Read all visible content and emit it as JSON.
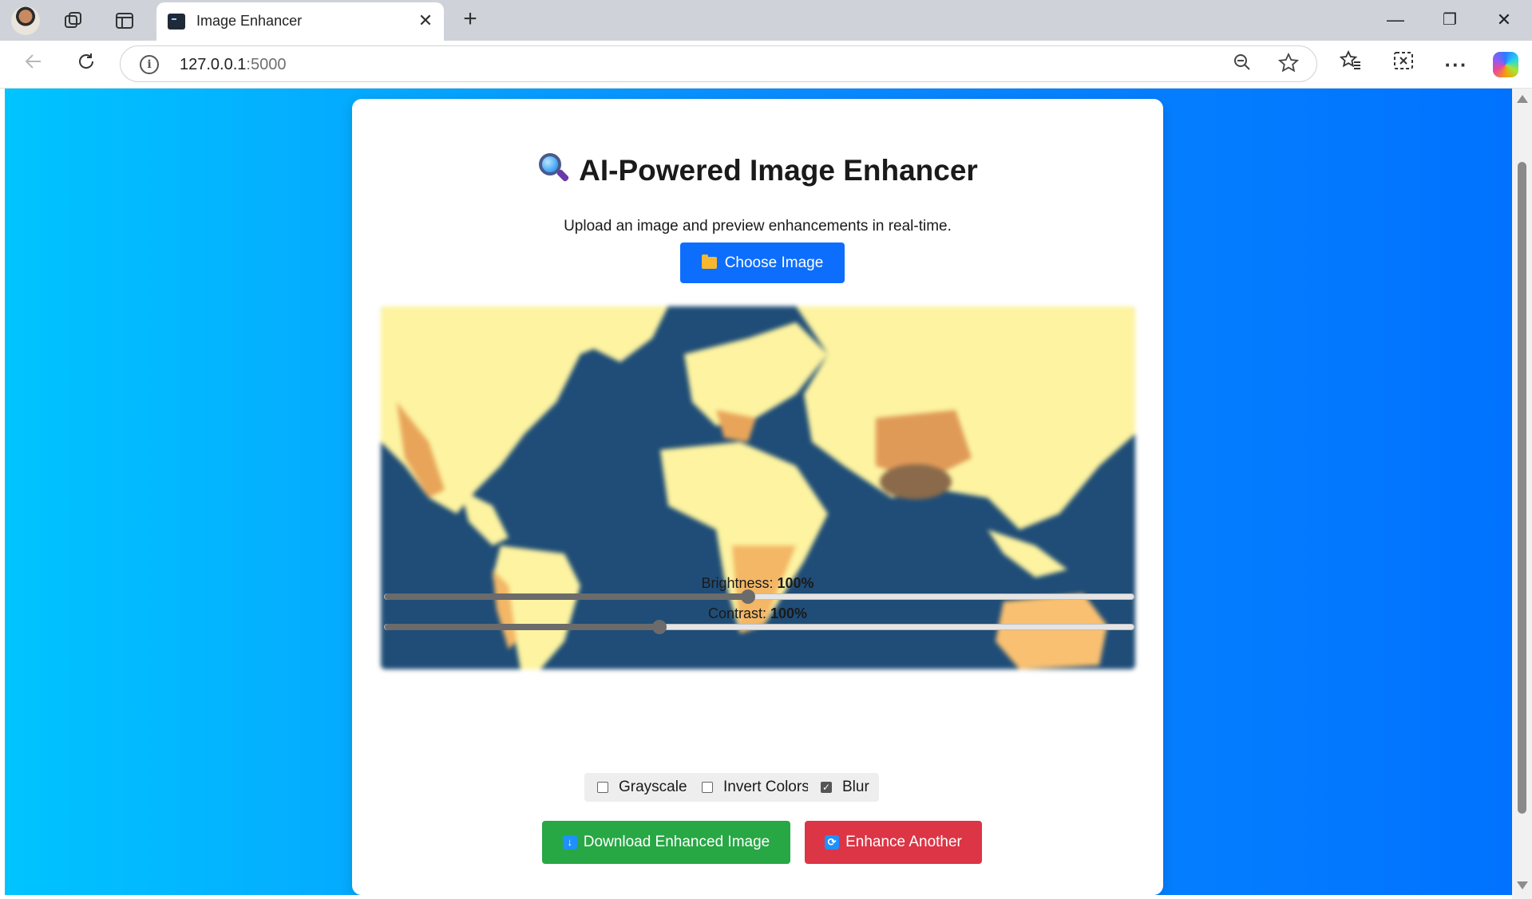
{
  "browser": {
    "tab_title": "Image Enhancer",
    "tab_close": "✕",
    "new_tab": "+",
    "url_host": "127.0.0.1",
    "url_port": ":5000",
    "icons": [
      "profile-avatar",
      "workspaces-icon",
      "tab-actions-icon",
      "back-icon",
      "refresh-icon",
      "info-icon",
      "zoom-out-icon",
      "star-icon",
      "favorites-icon",
      "screenshot-icon",
      "more-icon",
      "copilot-icon"
    ],
    "window": {
      "minimize": "—",
      "restore": "❐",
      "close": "✕"
    }
  },
  "page": {
    "title": "AI-Powered Image Enhancer",
    "subtitle": "Upload an image and preview enhancements in real-time.",
    "choose_button": "Choose Image",
    "image_alt": "World map",
    "brightness": {
      "label": "Brightness:",
      "value": "100%",
      "level": 0.485
    },
    "contrast": {
      "label": "Contrast:",
      "value": "100%",
      "level": 0.367
    },
    "options": [
      {
        "label": "Grayscale",
        "checked": false
      },
      {
        "label": "Invert Colors",
        "checked": false
      },
      {
        "label": "Blur",
        "checked": true
      }
    ],
    "download_button": "Download Enhanced Image",
    "another_button": "Enhance Another",
    "colors": {
      "primary": "#0d6efd",
      "success": "#28a745",
      "danger": "#dc3545",
      "bg_left": "#00c4ff",
      "bg_right": "#0072ff"
    }
  }
}
